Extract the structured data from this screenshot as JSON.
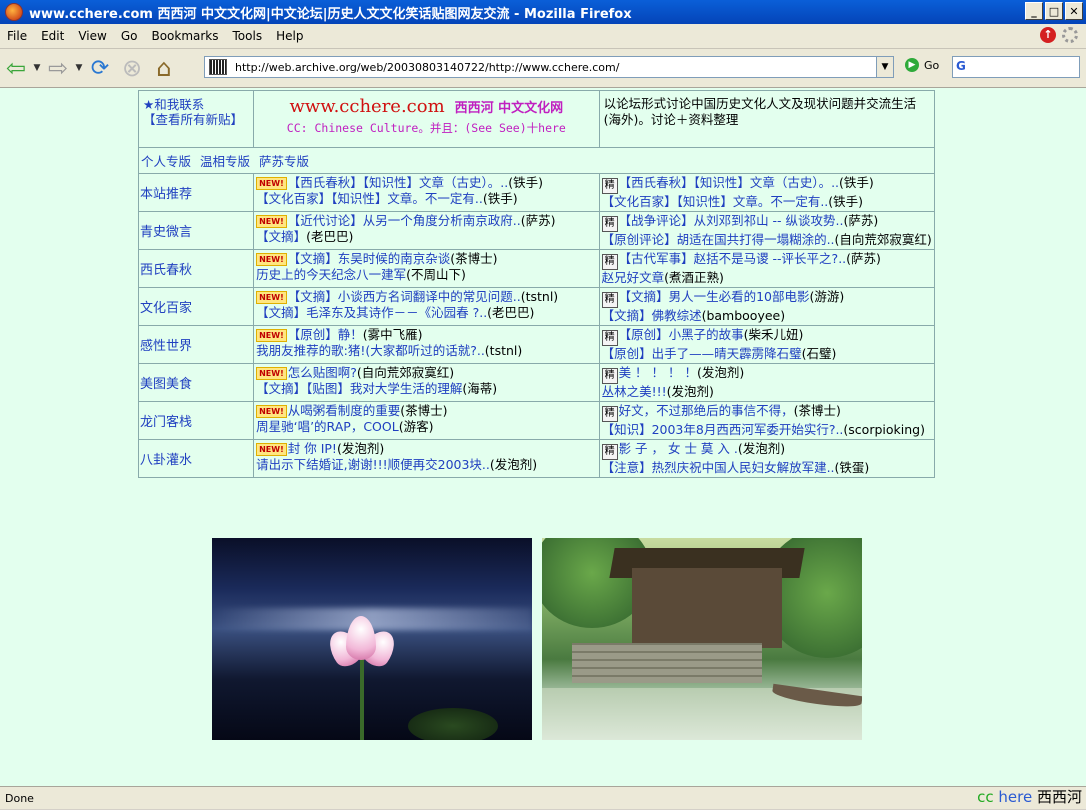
{
  "window": {
    "title": "www.cchere.com 西西河 中文文化网|中文论坛|历史人文文化笑话贴图网友交流 - Mozilla Firefox",
    "min": "_",
    "max": "□",
    "close": "✕"
  },
  "menu": [
    "File",
    "Edit",
    "View",
    "Go",
    "Bookmarks",
    "Tools",
    "Help"
  ],
  "nav": {
    "url": "http://web.archive.org/web/20030803140722/http://www.cchere.com/",
    "go_label": "Go",
    "search_icon": "G"
  },
  "header": {
    "contact": "★和我联系",
    "view_new": "【查看所有新贴】",
    "brand": "www.cchere.com",
    "brand_cn": "西西河 中文文化网",
    "tagline": "CC: Chinese Culture。并且：(See See)十here",
    "desc": "以论坛形式讨论中国历史文化人文及现状问题并交流生活(海外)。讨论＋资料整理"
  },
  "sections": [
    "个人专版",
    "温相专版",
    "萨苏专版"
  ],
  "badges": {
    "new": "NEW!",
    "jing": "精"
  },
  "rows": [
    {
      "category": "本站推荐",
      "left": [
        {
          "link": "【西氏春秋】【知识性】文章（古史）。..",
          "author": "(铁手)"
        },
        {
          "link": "【文化百家】【知识性】文章。不一定有..",
          "author": "(铁手)"
        }
      ],
      "right": [
        {
          "link": "【西氏春秋】【知识性】文章（古史）。..",
          "author": "(铁手)"
        },
        {
          "link": "【文化百家】【知识性】文章。不一定有..",
          "author": "(铁手)"
        }
      ]
    },
    {
      "category": "青史微言",
      "left": [
        {
          "link": "【近代讨论】从另一个角度分析南京政府..",
          "author": "(萨苏)"
        },
        {
          "link": "【文摘】",
          "author": "(老巴巴)"
        }
      ],
      "right": [
        {
          "link": "【战争评论】从刘邓到祁山 -- 纵谈攻势..",
          "author": "(萨苏)"
        },
        {
          "link": "【原创评论】胡适在国共打得一塌糊涂的..",
          "author": "(自向荒郊寂寞红)"
        }
      ]
    },
    {
      "category": "西氏春秋",
      "left": [
        {
          "link": "【文摘】东吴时候的南京杂谈",
          "author": "(茶博士)"
        },
        {
          "link": "历史上的今天纪念八一建军",
          "author": "(不周山下)"
        }
      ],
      "right": [
        {
          "link": "【古代军事】赵括不是马谡 --评长平之?..",
          "author": "(萨苏)"
        },
        {
          "link": "赵兄好文章",
          "author": "(煮酒正熟)"
        }
      ]
    },
    {
      "category": "文化百家",
      "left": [
        {
          "link": "【文摘】小谈西方名词翻译中的常见问题..",
          "author": "(tstnl)"
        },
        {
          "link": "【文摘】毛泽东及其诗作－－《沁园春 ?..",
          "author": "(老巴巴)"
        }
      ],
      "right": [
        {
          "link": "【文摘】男人一生必看的10部电影",
          "author": "(游游)"
        },
        {
          "link": "【文摘】佛教综述",
          "author": "(bambooyee)"
        }
      ]
    },
    {
      "category": "感性世界",
      "left": [
        {
          "link": "【原创】静！",
          "author": "(雾中飞雁)"
        },
        {
          "link": "我朋友推荐的歌:猪!(大家都听过的话就?..",
          "author": "(tstnl)"
        }
      ],
      "right": [
        {
          "link": "【原创】小黑子的故事",
          "author": "(柴禾儿妞)"
        },
        {
          "link": "【原创】出手了——晴天霹雳降石璧",
          "author": "(石璧)"
        }
      ]
    },
    {
      "category": "美图美食",
      "left": [
        {
          "link": "怎么贴图啊?",
          "author": "(自向荒郊寂寞红)"
        },
        {
          "link": "【文摘】【贴图】我对大学生活的理解",
          "author": "(海蒂)"
        }
      ],
      "right": [
        {
          "link": "美 ！ ！ ！ ！",
          "author": "(发泡剂)"
        },
        {
          "link": "丛林之美!!!",
          "author": "(发泡剂)"
        }
      ]
    },
    {
      "category": "龙门客栈",
      "left": [
        {
          "link": "从喝粥看制度的重要",
          "author": "(茶博士)"
        },
        {
          "link": "周星驰‘唱’的RAP，COOL",
          "author": "(游客)"
        }
      ],
      "right": [
        {
          "link": "好文，不过那绝后的事信不得，",
          "author": "(茶博士)"
        },
        {
          "link": "【知识】2003年8月西西河军委开始实行?..",
          "author": "(scorpioking)"
        }
      ]
    },
    {
      "category": "八卦灌水",
      "left": [
        {
          "link": "封 你 IP!",
          "author": "(发泡剂)"
        },
        {
          "link": "请出示下结婚证,谢谢!!!顺便再交2003块..",
          "author": "(发泡剂)"
        }
      ],
      "right": [
        {
          "link": "影 子 ， 女 士 莫 入 .",
          "author": "(发泡剂)"
        },
        {
          "link": "【注意】热烈庆祝中国人民妇女解放军建..",
          "author": "(铁蛋)"
        }
      ]
    }
  ],
  "status": {
    "text": "Done",
    "logo_cc": "cc",
    "logo_here": "here",
    "logo_cn": "西西河"
  }
}
